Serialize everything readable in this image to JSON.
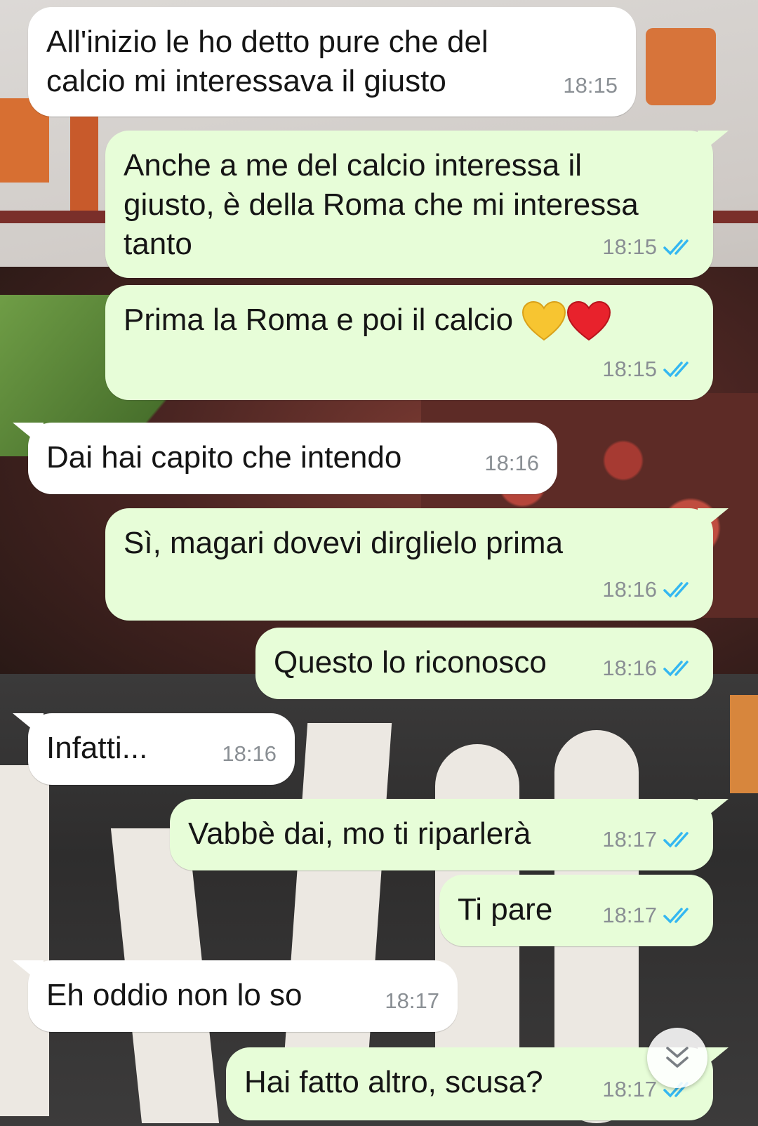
{
  "messages": [
    {
      "dir": "in",
      "text": "All'inizio le ho detto pure che del\ncalcio mi interessava il giusto",
      "time": "18:15"
    },
    {
      "dir": "out",
      "text": "Anche a me del calcio interessa il\ngiusto, è della Roma che mi interessa\ntanto",
      "time": "18:15",
      "status": "read"
    },
    {
      "dir": "out",
      "text": "Prima la Roma e poi il calcio",
      "emoji": [
        "yellow-heart",
        "red-heart"
      ],
      "time": "18:15",
      "status": "read"
    },
    {
      "dir": "in",
      "text": "Dai hai capito che intendo",
      "time": "18:16"
    },
    {
      "dir": "out",
      "text": "Sì, magari dovevi dirglielo prima",
      "time": "18:16",
      "status": "read"
    },
    {
      "dir": "out",
      "text": "Questo lo riconosco",
      "time": "18:16",
      "status": "read"
    },
    {
      "dir": "in",
      "text": "Infatti...",
      "time": "18:16"
    },
    {
      "dir": "out",
      "text": "Vabbè dai, mo ti riparlerà",
      "time": "18:17",
      "status": "read"
    },
    {
      "dir": "out",
      "text": "Ti pare",
      "time": "18:17",
      "status": "read"
    },
    {
      "dir": "in",
      "text": "Eh oddio non lo so",
      "time": "18:17"
    },
    {
      "dir": "out",
      "text": "Hai fatto altro, scusa?",
      "time": "18:17",
      "status": "read"
    }
  ],
  "colors": {
    "incoming_bubble": "#ffffff",
    "outgoing_bubble": "#e7fdd8",
    "read_ticks": "#34b7f1",
    "timestamp": "#8a8f94"
  },
  "icons": {
    "read_status": "double-check-icon",
    "scroll_down": "double-chevron-down-icon"
  }
}
